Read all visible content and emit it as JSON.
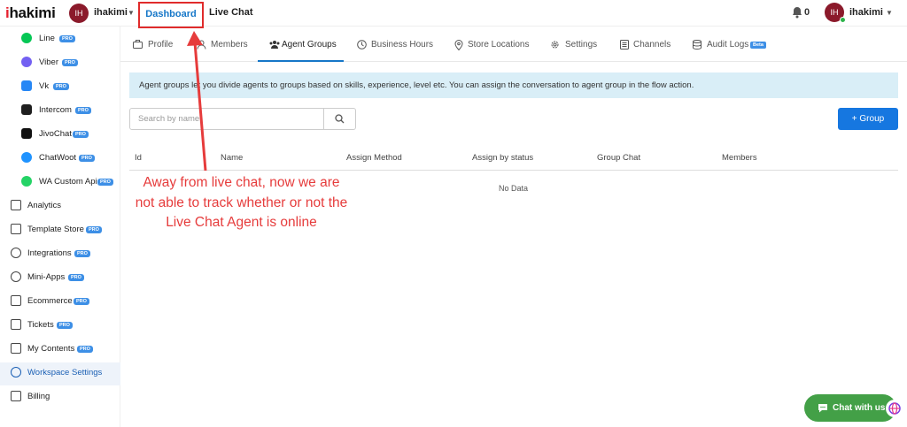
{
  "topbar": {
    "logo_prefix": "i",
    "logo_rest": "hakimi",
    "workspace_initials": "IH",
    "workspace_name": "ihakimi",
    "nav_dashboard": "Dashboard",
    "nav_live_chat": "Live Chat",
    "notification_count": "0",
    "user_initials": "IH",
    "user_name": "ihakimi"
  },
  "sidebar": {
    "pro_badge": "PRO",
    "items": [
      {
        "label": "Line",
        "pro": true
      },
      {
        "label": "Viber",
        "pro": true
      },
      {
        "label": "Vk",
        "pro": true
      },
      {
        "label": "Intercom",
        "pro": true
      },
      {
        "label": "JivoChat",
        "pro": true
      },
      {
        "label": "ChatWoot",
        "pro": true
      },
      {
        "label": "WA Custom Api",
        "pro": true
      },
      {
        "label": "Analytics",
        "pro": false
      },
      {
        "label": "Template Store",
        "pro": true
      },
      {
        "label": "Integrations",
        "pro": true
      },
      {
        "label": "Mini-Apps",
        "pro": true
      },
      {
        "label": "Ecommerce",
        "pro": true
      },
      {
        "label": "Tickets",
        "pro": true
      },
      {
        "label": "My Contents",
        "pro": true
      },
      {
        "label": "Workspace Settings",
        "pro": false,
        "active": true
      },
      {
        "label": "Billing",
        "pro": false
      }
    ]
  },
  "tabs": {
    "items": [
      {
        "label": "Profile"
      },
      {
        "label": "Members"
      },
      {
        "label": "Agent Groups",
        "active": true
      },
      {
        "label": "Business Hours"
      },
      {
        "label": "Store Locations"
      },
      {
        "label": "Settings"
      },
      {
        "label": "Channels"
      },
      {
        "label": "Audit Logs",
        "badge": "Beta"
      }
    ]
  },
  "content": {
    "info_text": "Agent groups let you divide agents to groups based on skills, experience, level etc. You can assign the conversation to agent group in the flow action.",
    "search_placeholder": "Search by name",
    "add_group_label": "Group",
    "table_headers": [
      "Id",
      "Name",
      "Assign Method",
      "Assign by status",
      "Group Chat",
      "Members"
    ],
    "no_data": "No Data"
  },
  "annotation": {
    "text": "Away from live chat, now we are not able to track whether or not the Live Chat Agent is online",
    "color": "#e63c3c"
  },
  "chat_widget": {
    "label": "Chat with us"
  },
  "colors": {
    "accent": "#1677c8",
    "brand_red": "#e5202e",
    "avatar": "#8b1a2b",
    "pro_badge": "#3d8fe6",
    "chat_widget": "#43a047"
  }
}
